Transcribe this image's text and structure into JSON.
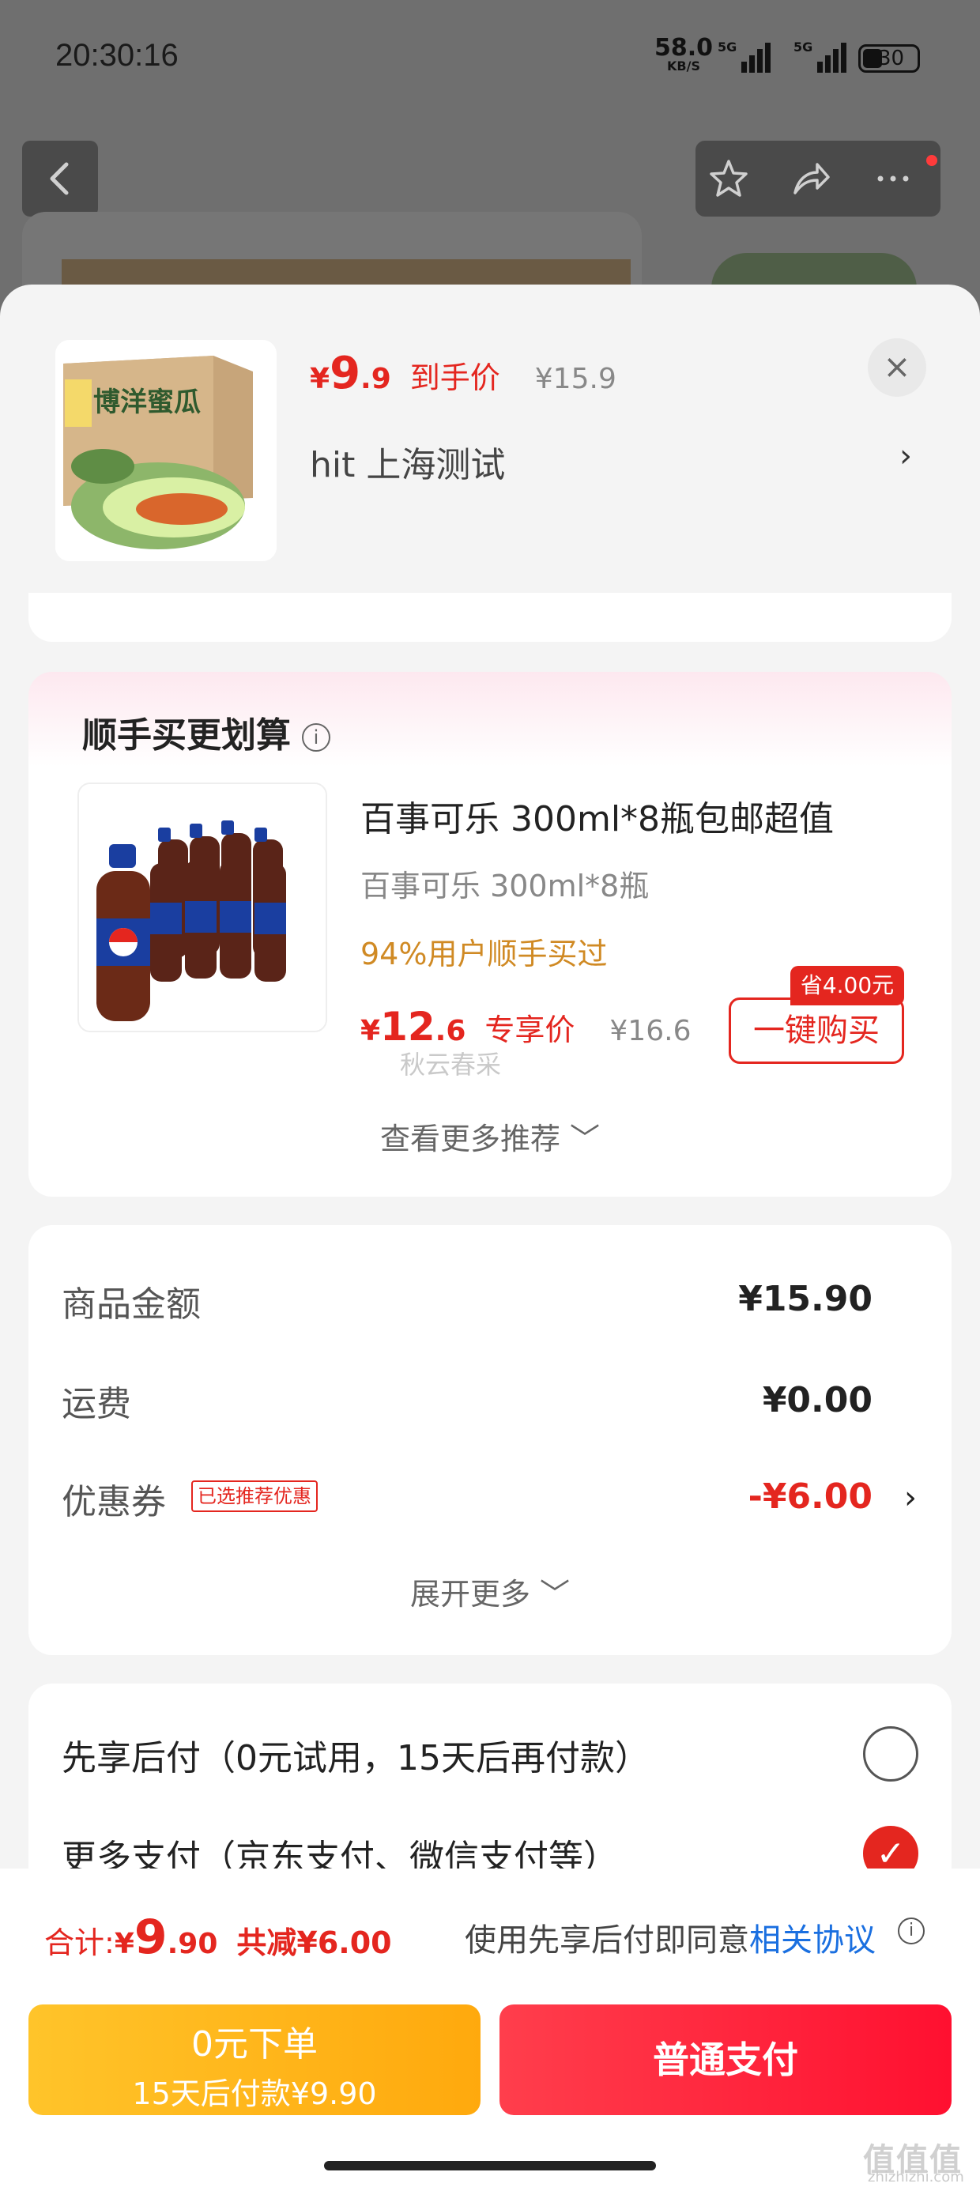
{
  "status_bar": {
    "time": "20:30:16",
    "net_speed": "58.0",
    "net_unit": "KB/S",
    "signal1": "5G",
    "signal2": "5G",
    "battery": "30"
  },
  "product": {
    "currency": "¥",
    "price_int": "9",
    "price_dec": ".9",
    "price_label": "到手价",
    "orig_price": "¥15.9",
    "address": "hit  上海测试",
    "thumb_text": "博洋蜜瓜"
  },
  "upsell": {
    "title": "顺手买更划算",
    "name": "百事可乐 300ml*8瓶包邮超值",
    "sub": "百事可乐 300ml*8瓶",
    "rate": "94%用户顺手买过",
    "currency": "¥",
    "price_int": "12",
    "price_dec": ".6",
    "price_label": "专享价",
    "orig_price": "¥16.6",
    "save_badge": "省4.00元",
    "buy_label": "一键购买",
    "more_label": "查看更多推荐 ﹀",
    "watermark": "秋云春采"
  },
  "amounts": {
    "goods_label": "商品金额",
    "goods_value": "¥15.90",
    "shipping_label": "运费",
    "shipping_value": "¥0.00",
    "coupon_label": "优惠券",
    "coupon_tag": "已选推荐优惠",
    "coupon_value": "-¥6.00",
    "expand_label": "展开更多 ﹀"
  },
  "payment": {
    "later_option": "先享后付（0元试用，15天后再付款）",
    "more_option": "更多支付（京东支付、微信支付等）"
  },
  "footer": {
    "total_label": "合计: ",
    "total_currency": "¥",
    "total_int": "9",
    "total_dec": ".90",
    "reduce": "共减¥6.00",
    "agree_text": "使用先享后付即同意",
    "agree_link": "相关协议",
    "later_btn_line1": "0元下单",
    "later_btn_line2": "15天后付款¥9.90",
    "pay_btn": "普通支付",
    "watermark_logo": "值值值",
    "watermark_url": "zhizhizhi.com"
  },
  "colors": {
    "accent_red": "#e4261f",
    "link_blue": "#1a6fe0",
    "orange": "#d08a24",
    "yellow_btn": "#ffb41c"
  }
}
